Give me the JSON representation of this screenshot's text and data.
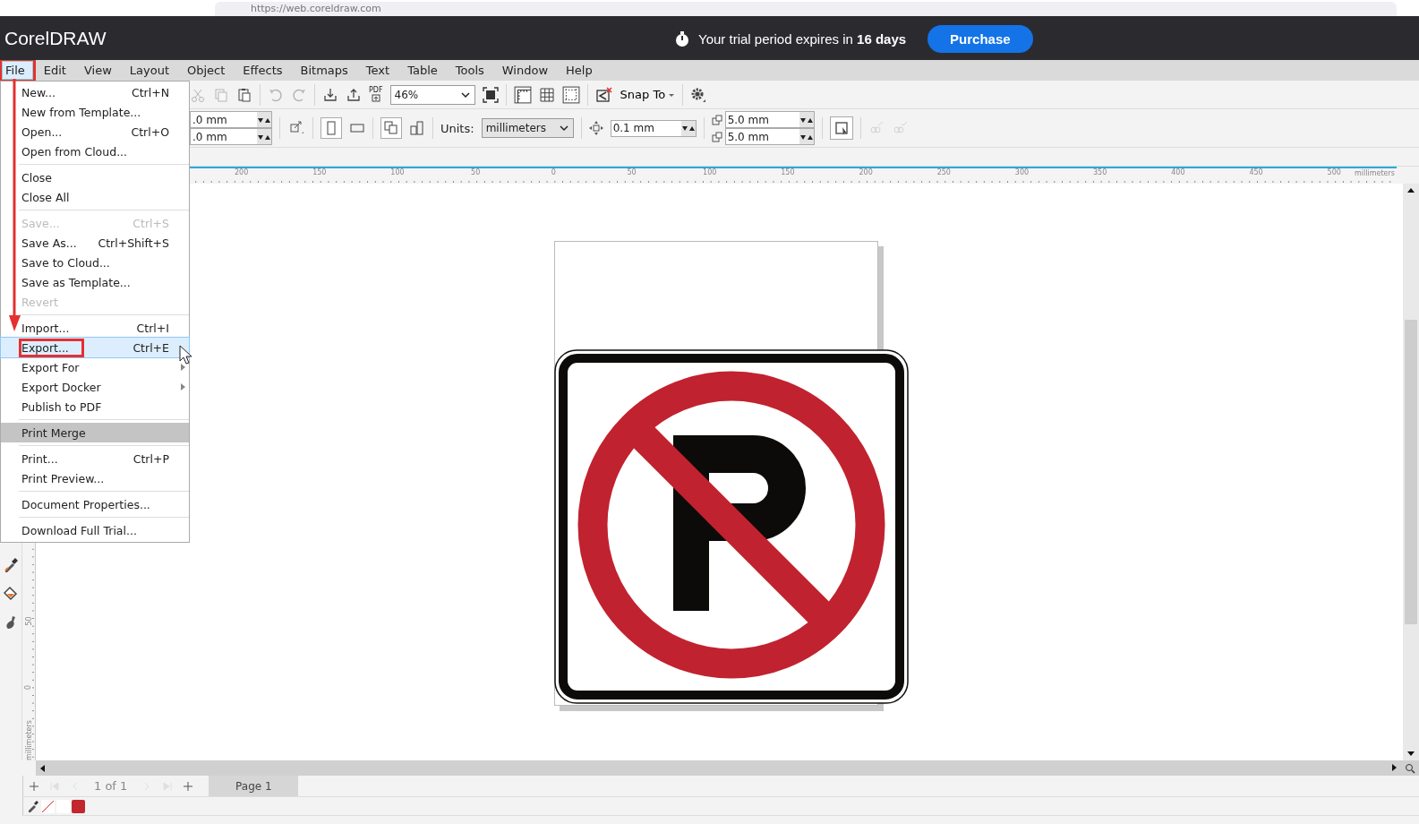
{
  "browser": {
    "url": "https://web.coreldraw.com"
  },
  "header": {
    "logo": "CorelDRAW",
    "trial_text": "Your trial period expires in **16 days**",
    "purchase_button": "Purchase"
  },
  "menubar": [
    {
      "label": "File",
      "selected": true,
      "annotated": true
    },
    {
      "label": "Edit",
      "selected": false,
      "annotated": false
    },
    {
      "label": "View",
      "selected": false,
      "annotated": false
    },
    {
      "label": "Layout",
      "selected": false,
      "annotated": false
    },
    {
      "label": "Object",
      "selected": false,
      "annotated": false
    },
    {
      "label": "Effects",
      "selected": false,
      "annotated": false
    },
    {
      "label": "Bitmaps",
      "selected": false,
      "annotated": false
    },
    {
      "label": "Text",
      "selected": false,
      "annotated": false
    },
    {
      "label": "Table",
      "selected": false,
      "annotated": false
    },
    {
      "label": "Tools",
      "selected": false,
      "annotated": false
    },
    {
      "label": "Window",
      "selected": false,
      "annotated": false
    },
    {
      "label": "Help",
      "selected": false,
      "annotated": false
    }
  ],
  "file_menu": [
    {
      "kind": "item",
      "label": "New...",
      "shortcut": "Ctrl+N",
      "disabled": false,
      "selected": false,
      "highlighted": false,
      "submenu": false,
      "annotated": false
    },
    {
      "kind": "item",
      "label": "New from Template...",
      "disabled": false,
      "selected": false,
      "highlighted": false,
      "submenu": false,
      "annotated": false
    },
    {
      "kind": "item",
      "label": "Open...",
      "shortcut": "Ctrl+O",
      "disabled": false,
      "selected": false,
      "highlighted": false,
      "submenu": false,
      "annotated": false
    },
    {
      "kind": "item",
      "label": "Open from Cloud...",
      "disabled": false,
      "selected": false,
      "highlighted": false,
      "submenu": false,
      "annotated": false
    },
    {
      "kind": "separator"
    },
    {
      "kind": "item",
      "label": "Close",
      "disabled": false,
      "selected": false,
      "highlighted": false,
      "submenu": false,
      "annotated": false
    },
    {
      "kind": "item",
      "label": "Close All",
      "disabled": false,
      "selected": false,
      "highlighted": false,
      "submenu": false,
      "annotated": false
    },
    {
      "kind": "separator"
    },
    {
      "kind": "item",
      "label": "Save...",
      "shortcut": "Ctrl+S",
      "disabled": true,
      "selected": false,
      "highlighted": false,
      "submenu": false,
      "annotated": false
    },
    {
      "kind": "item",
      "label": "Save As...",
      "shortcut": "Ctrl+Shift+S",
      "disabled": false,
      "selected": false,
      "highlighted": false,
      "submenu": false,
      "annotated": false
    },
    {
      "kind": "item",
      "label": "Save to Cloud...",
      "disabled": false,
      "selected": false,
      "highlighted": false,
      "submenu": false,
      "annotated": false
    },
    {
      "kind": "item",
      "label": "Save as Template...",
      "disabled": false,
      "selected": false,
      "highlighted": false,
      "submenu": false,
      "annotated": false
    },
    {
      "kind": "item",
      "label": "Revert",
      "disabled": true,
      "selected": false,
      "highlighted": false,
      "submenu": false,
      "annotated": false
    },
    {
      "kind": "separator"
    },
    {
      "kind": "item",
      "label": "Import...",
      "shortcut": "Ctrl+I",
      "disabled": false,
      "selected": false,
      "highlighted": false,
      "submenu": false,
      "annotated": false
    },
    {
      "kind": "item",
      "label": "Export...",
      "shortcut": "Ctrl+E",
      "disabled": false,
      "selected": true,
      "highlighted": false,
      "submenu": false,
      "annotated": true
    },
    {
      "kind": "item",
      "label": "Export For",
      "disabled": false,
      "selected": false,
      "highlighted": false,
      "submenu": true,
      "annotated": false
    },
    {
      "kind": "item",
      "label": "Export Docker",
      "disabled": false,
      "selected": false,
      "highlighted": false,
      "submenu": true,
      "annotated": false
    },
    {
      "kind": "item",
      "label": "Publish to PDF",
      "disabled": false,
      "selected": false,
      "highlighted": false,
      "submenu": false,
      "annotated": false
    },
    {
      "kind": "separator"
    },
    {
      "kind": "item",
      "label": "Print Merge",
      "disabled": false,
      "selected": false,
      "highlighted": true,
      "submenu": false,
      "annotated": false
    },
    {
      "kind": "separator"
    },
    {
      "kind": "item",
      "label": "Print...",
      "shortcut": "Ctrl+P",
      "disabled": false,
      "selected": false,
      "highlighted": false,
      "submenu": false,
      "annotated": false
    },
    {
      "kind": "item",
      "label": "Print Preview...",
      "disabled": false,
      "selected": false,
      "highlighted": false,
      "submenu": false,
      "annotated": false
    },
    {
      "kind": "separator"
    },
    {
      "kind": "item",
      "label": "Document Properties...",
      "disabled": false,
      "selected": false,
      "highlighted": false,
      "submenu": false,
      "annotated": false
    },
    {
      "kind": "separator"
    },
    {
      "kind": "item",
      "label": "Download Full Trial...",
      "disabled": false,
      "selected": false,
      "highlighted": false,
      "submenu": false,
      "annotated": false
    }
  ],
  "toolbar": {
    "pdf_label": "PDF",
    "zoom": "46%",
    "snap_to": "Snap To"
  },
  "property_bar": {
    "width_field": ".0 mm",
    "height_field": ".0 mm",
    "units_label": "Units:",
    "units": "millimeters",
    "nudge": "0.1 mm",
    "dup_x": "5.0 mm",
    "dup_y": "5.0 mm"
  },
  "rulers": {
    "h_labels": [
      "200",
      "150",
      "100",
      "50",
      "0",
      "50",
      "100",
      "150",
      "200",
      "250",
      "300",
      "350",
      "400",
      "450",
      "500"
    ],
    "h_unit": "millimeters",
    "v_labels": [
      "50",
      "0"
    ],
    "v_unit": "millimeters"
  },
  "page_nav": {
    "counter": "1 of 1",
    "page_tab": "Page 1"
  },
  "color_swatches": [
    {
      "color": "#ffffff"
    },
    {
      "color": "#c1272d"
    }
  ]
}
